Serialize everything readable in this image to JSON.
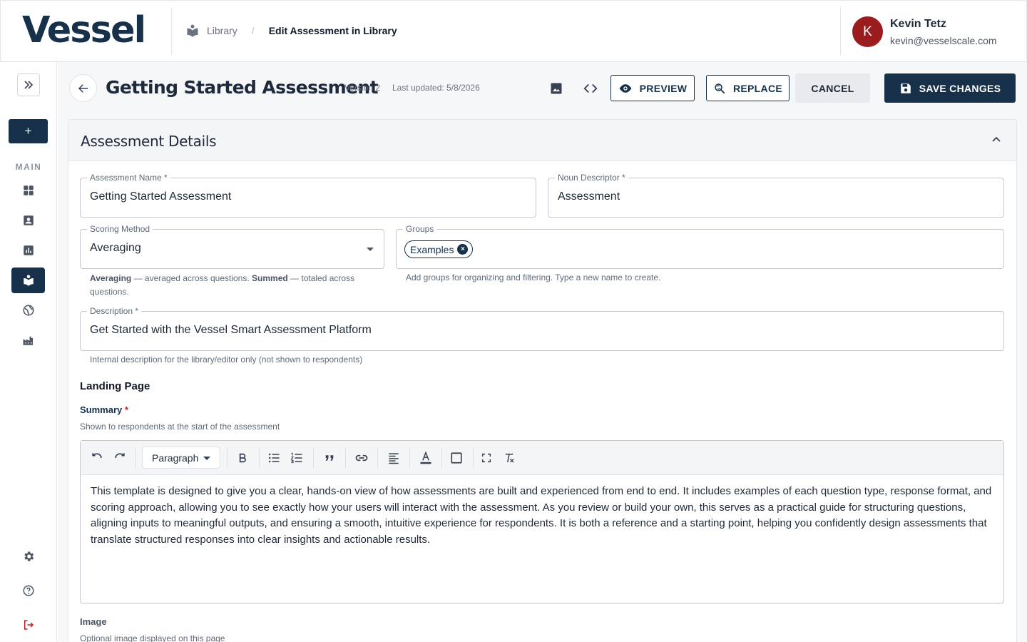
{
  "header": {
    "logo": "Vessel",
    "breadcrumb_root": "Library",
    "breadcrumb_sep": "/",
    "breadcrumb_current": "Edit Assessment in Library",
    "user_initial": "K",
    "user_name": "Kevin Tetz",
    "user_email": "kevin@vesselscale.com",
    "avatar_color": "#9b1c1c"
  },
  "sidebar": {
    "add_label": "+",
    "section_label": "MAIN",
    "items": [
      {
        "icon": "dashboard-icon",
        "active": false
      },
      {
        "icon": "contact-card-icon",
        "active": false
      },
      {
        "icon": "bar-chart-icon",
        "active": false
      },
      {
        "icon": "library-book-icon",
        "active": true
      },
      {
        "icon": "globe-icon",
        "active": false
      },
      {
        "icon": "factory-icon",
        "active": false
      }
    ],
    "bottom_items": [
      "settings-icon",
      "help-icon",
      "logout-icon"
    ]
  },
  "page": {
    "title": "Getting Started Assessment",
    "version": "Version 2",
    "last_updated": "Last updated: 5/8/2026",
    "preview_label": "PREVIEW",
    "replace_label": "REPLACE",
    "cancel_label": "CANCEL",
    "save_label": "SAVE CHANGES"
  },
  "details": {
    "title": "Assessment Details",
    "name_label": "Assessment Name *",
    "name_value": "Getting Started Assessment",
    "noun_label": "Noun Descriptor *",
    "noun_value": "Assessment",
    "scoring_label": "Scoring Method",
    "scoring_value": "Averaging",
    "scoring_help_avg_term": "Averaging",
    "scoring_help_avg_text": " — averaged across questions. ",
    "scoring_help_sum_term": "Summed",
    "scoring_help_sum_text": " — totaled across questions.",
    "groups_label": "Groups",
    "groups_chip": "Examples",
    "groups_help": "Add groups for organizing and filtering. Type a new name to create.",
    "description_label": "Description *",
    "description_value": "Get Started with the Vessel Smart Assessment Platform",
    "description_help": "Internal description for the library/editor only (not shown to respondents)"
  },
  "landing": {
    "heading": "Landing Page",
    "summary_label": "Summary",
    "summary_required": "*",
    "summary_help": "Shown to respondents at the start of the assessment",
    "block_format": "Paragraph",
    "summary_text": "This template is designed to give you a clear, hands-on view of how assessments are built and experienced from end to end. It includes examples of each question type, response format, and scoring approach, allowing you to see exactly how your users will interact with the assessment. As you review or build your own, this serves as a practical guide for structuring questions, aligning inputs to meaningful outputs, and ensuring a smooth, intuitive experience for respondents. It is both a reference and a starting point, helping you confidently design assessments that translate structured responses into clear insights and actionable results.",
    "image_label": "Image",
    "image_help": "Optional image displayed on this page"
  },
  "colors": {
    "brand": "#163149",
    "danger": "#c81e1e"
  }
}
